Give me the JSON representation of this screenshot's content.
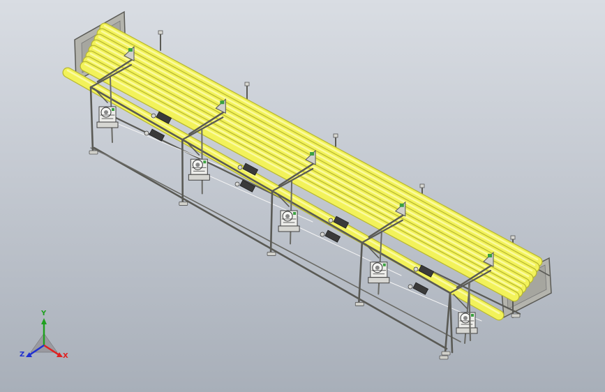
{
  "viewport": {
    "background_top": "#d9dde3",
    "background_bottom": "#a8afb9"
  },
  "model": {
    "pipe_color": "#f2f25a",
    "pipe_edge_color": "#b8b830",
    "frame_color": "#c9c9c2",
    "frame_edge_color": "#5a5a55",
    "panel_color": "#b4b4ad",
    "pipe_count": 9,
    "module_count": 5
  },
  "triad": {
    "x_label": "X",
    "y_label": "Y",
    "z_label": "Z",
    "x_color": "#e02020",
    "y_color": "#20a020",
    "z_color": "#2030d0"
  }
}
